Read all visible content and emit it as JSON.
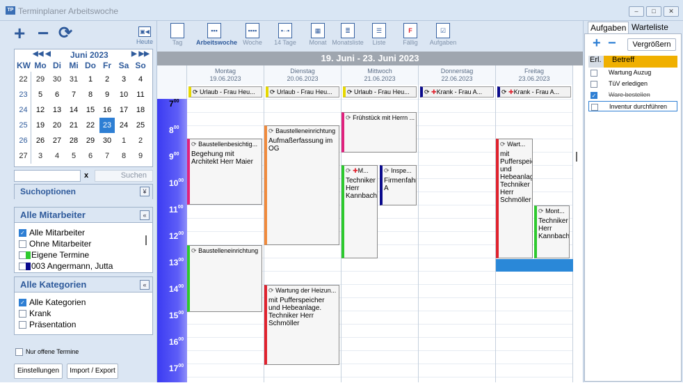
{
  "window": {
    "title": "Terminplaner Arbeitswoche",
    "icon_text": "TP",
    "min": "–",
    "max": "□",
    "close": "✕"
  },
  "left_toolbar": {
    "add": "+",
    "remove": "−",
    "refresh": "⟳",
    "heute_icon": "▣◀",
    "heute": "Heute"
  },
  "calendar": {
    "prev": "◀◀ ◀",
    "next": "▶ ▶▶",
    "month": "Juni 2023",
    "headers": [
      "KW",
      "Mo",
      "Di",
      "Mi",
      "Do",
      "Fr",
      "Sa",
      "So"
    ],
    "weeks": [
      [
        "22",
        "29",
        "30",
        "31",
        "1",
        "2",
        "3",
        "4"
      ],
      [
        "23",
        "5",
        "6",
        "7",
        "8",
        "9",
        "10",
        "11"
      ],
      [
        "24",
        "12",
        "13",
        "14",
        "15",
        "16",
        "17",
        "18"
      ],
      [
        "25",
        "19",
        "20",
        "21",
        "22",
        "23",
        "24",
        "25"
      ],
      [
        "26",
        "26",
        "27",
        "28",
        "29",
        "30",
        "1",
        "2"
      ],
      [
        "27",
        "3",
        "4",
        "5",
        "6",
        "7",
        "8",
        "9"
      ]
    ]
  },
  "search": {
    "value": "",
    "clear": "x",
    "button": "Suchen"
  },
  "suchoptionen": {
    "title": "Suchoptionen",
    "toggle": "¥"
  },
  "mitarbeiter": {
    "title": "Alle Mitarbeiter",
    "toggle": "«",
    "items": [
      {
        "label": "Alle Mitarbeiter",
        "checked": true
      },
      {
        "label": "Ohne Mitarbeiter",
        "checked": false
      },
      {
        "label": "Eigene Termine",
        "checked": false,
        "color": "#2dc92d"
      },
      {
        "label": "003 Angermann, Jutta",
        "checked": false,
        "color": "#0a0a8c"
      }
    ]
  },
  "kategorien": {
    "title": "Alle Kategorien",
    "toggle": "«",
    "items": [
      {
        "label": "Alle Kategorien",
        "checked": true
      },
      {
        "label": "Krank",
        "checked": false
      },
      {
        "label": "Präsentation",
        "checked": false
      }
    ]
  },
  "nur_offene": "Nur offene Termine",
  "einstellungen": "Einstellungen",
  "import_export": "Import / Export",
  "view_toolbar": [
    {
      "label": "Tag",
      "icon": "",
      "active": false
    },
    {
      "label": "Arbeitswoche",
      "icon": "▪▪▪",
      "active": true
    },
    {
      "label": "Woche",
      "icon": "▪▪▪▪",
      "active": false
    },
    {
      "label": "14 Tage",
      "icon": "▪··▪",
      "active": false
    },
    {
      "label": "Monat",
      "icon": "▦",
      "active": false
    },
    {
      "label": "Monatsliste",
      "icon": "≣",
      "active": false
    },
    {
      "label": "Liste",
      "icon": "☰",
      "active": false
    },
    {
      "label": "Fällig",
      "icon": "F",
      "active": false
    },
    {
      "label": "Aufgaben",
      "icon": "☑",
      "active": false
    }
  ],
  "date_range": "19. Juni - 23. Juni 2023",
  "days": [
    {
      "name": "Montag",
      "date": "19.06.2023",
      "allday": "Urlaub - Frau Heu...",
      "color": "#e6d800"
    },
    {
      "name": "Dienstag",
      "date": "20.06.2023",
      "allday": "Urlaub - Frau Heu...",
      "color": "#e6d800"
    },
    {
      "name": "Mittwoch",
      "date": "21.06.2023",
      "allday": "Urlaub - Frau Heu...",
      "color": "#e6d800"
    },
    {
      "name": "Donnerstag",
      "date": "22.06.2023",
      "allday": "Krank - Frau A...",
      "color": "#0a0a8c"
    },
    {
      "name": "Freitag",
      "date": "23.06.2023",
      "allday": "Krank - Frau A...",
      "color": "#0a0a8c"
    }
  ],
  "hours": [
    "7",
    "8",
    "9",
    "10",
    "11",
    "12",
    "13",
    "14",
    "15",
    "16",
    "17"
  ],
  "minutes": "00",
  "events": {
    "mon1_head": "Baustellenbesichtig...",
    "mon1_body": "Begehung mit Architekt Herr Maier",
    "mon2_head": "Baustelleneinrichtung",
    "tue1_head": "Baustelleneinrichtung",
    "tue1_body": "Aufmaßerfassung im OG",
    "tue2_head": "Wartung der Heizun...",
    "tue2_body": "mit Pufferspeicher und Hebeanlage. Techniker Herr Schmöller",
    "wed1_head": "Frühstück mit Herrn ...",
    "wed2_head": "M...",
    "wed2_body": "Techniker Herr Kannbacher",
    "wed3_head": "Inspe...",
    "wed3_body": "Firmenfahrzeug A",
    "fri1_head": "Wart...",
    "fri1_body": "mit Pufferspeicher und Hebeanlage. Techniker Herr Schmöller",
    "fri2_head": "Mont...",
    "fri2_body": "Techniker Herr Kannbacher"
  },
  "right": {
    "tab_aufgaben": "Aufgaben",
    "tab_warteliste": "Warteliste",
    "add": "+",
    "remove": "−",
    "vergroessern": "Vergrößern",
    "col_erl": "Erl.",
    "col_betreff": "Betreff",
    "tasks": [
      {
        "label": "Wartung Auzug",
        "checked": false
      },
      {
        "label": "TüV erledigen",
        "checked": false
      },
      {
        "label": "Ware bestellen",
        "checked": true
      },
      {
        "label": "Inventur durchführen",
        "checked": false
      }
    ]
  }
}
